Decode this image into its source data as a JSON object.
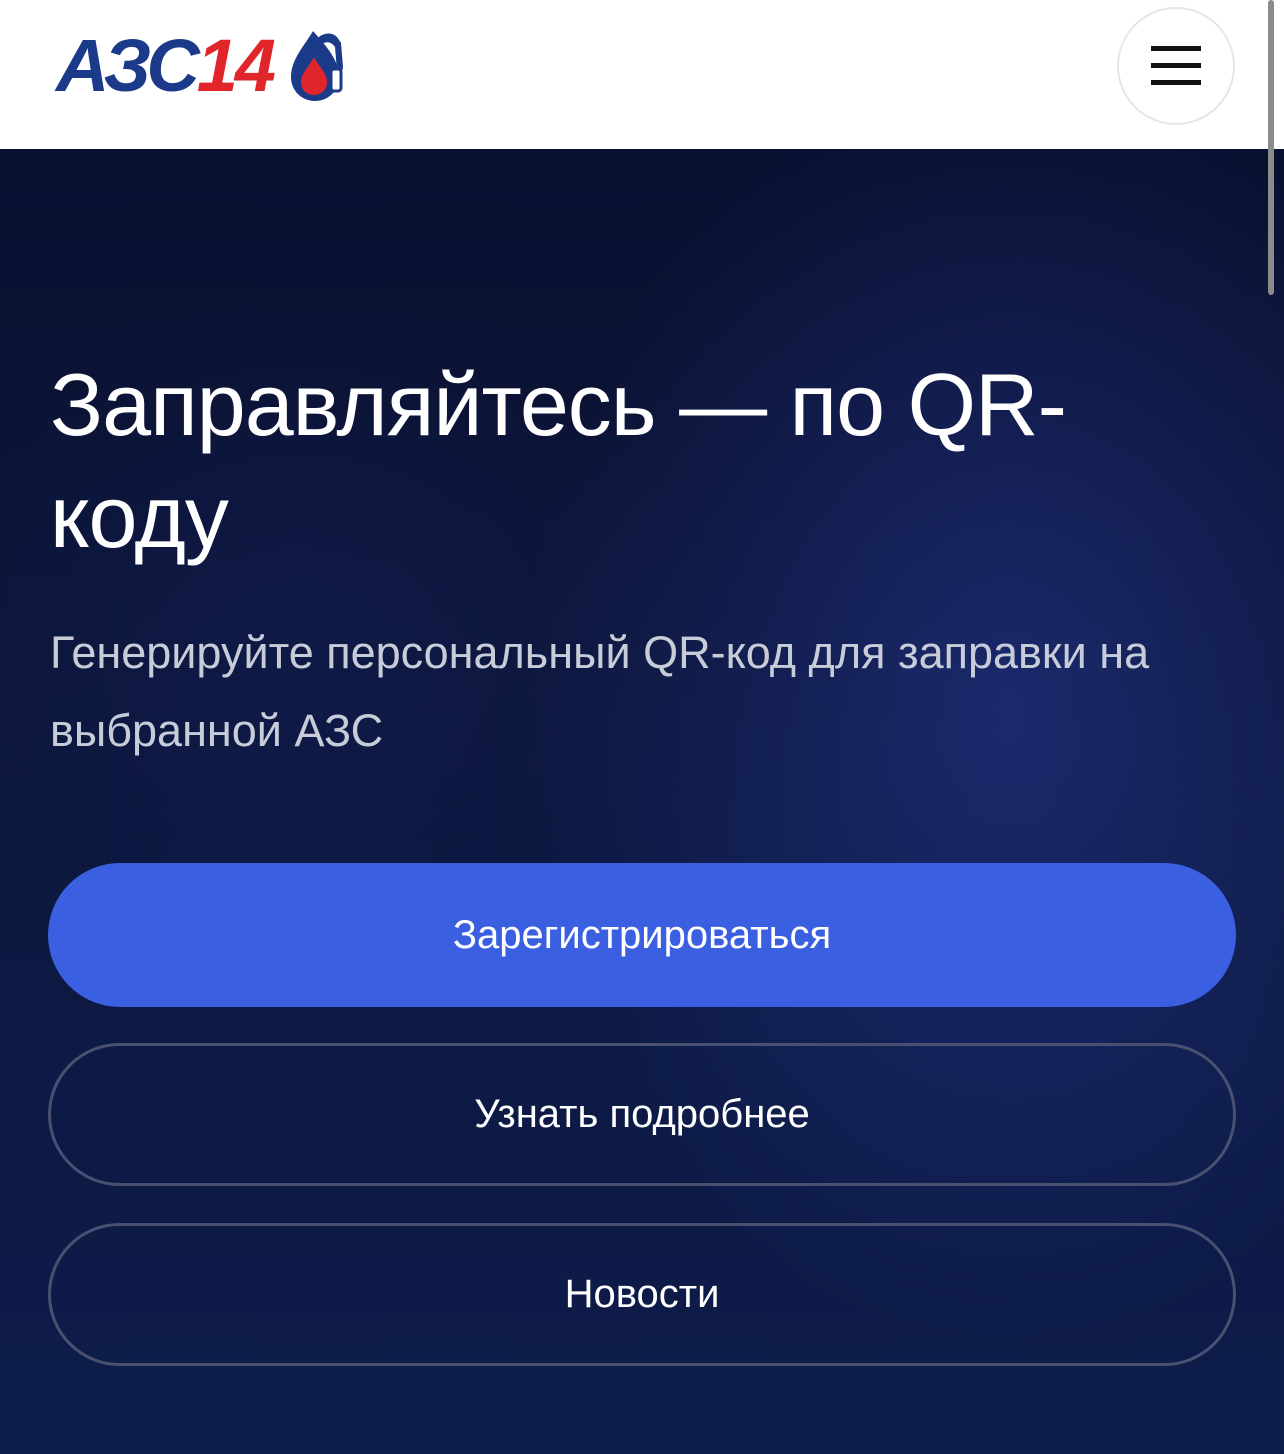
{
  "header": {
    "logo_letters": "АЗС",
    "logo_number": "14",
    "menu_icon": "hamburger-icon"
  },
  "hero": {
    "title": "Заправляйтесь — по QR-коду",
    "subtitle": "Генерируйте персональный QR-код для заправки на выбранной АЗС"
  },
  "buttons": {
    "register_label": "Зарегистрироваться",
    "more_label": "Узнать подробнее",
    "news_label": "Новости"
  },
  "colors": {
    "brand_blue": "#1b3a8a",
    "brand_red": "#e0262b",
    "primary_button": "#3a5fe0",
    "hero_background": "#0b1233"
  }
}
